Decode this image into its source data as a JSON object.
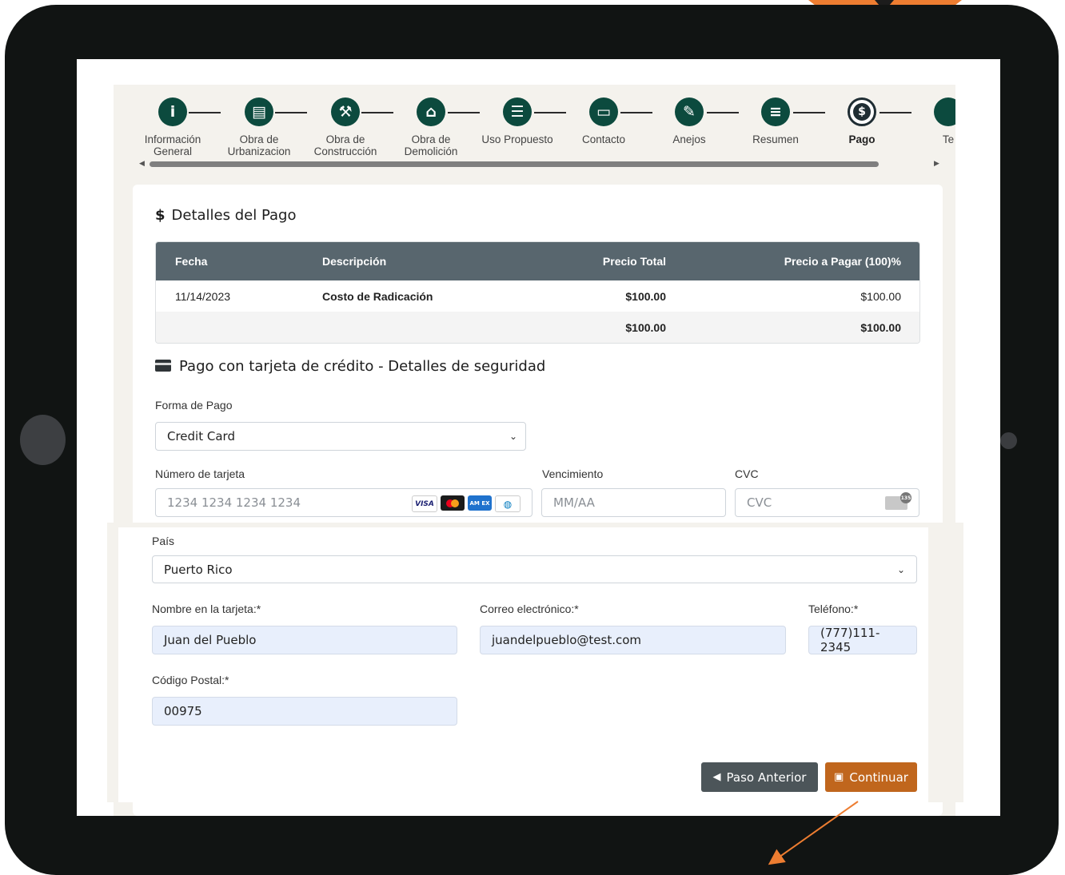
{
  "steps": [
    {
      "label": "Información General",
      "icon": "info-icon",
      "glyph": "i"
    },
    {
      "label": "Obra de Urbanizacion",
      "icon": "store-icon",
      "glyph": "▤"
    },
    {
      "label": "Obra de Construcción",
      "icon": "construction-worker-icon",
      "glyph": "⚒"
    },
    {
      "label": "Obra de Demolición",
      "icon": "house-icon",
      "glyph": "⌂"
    },
    {
      "label": "Uso Propuesto",
      "icon": "list-icon",
      "glyph": "☰"
    },
    {
      "label": "Contacto",
      "icon": "id-card-icon",
      "glyph": "▭"
    },
    {
      "label": "Anejos",
      "icon": "paperclip-icon",
      "glyph": "✎"
    },
    {
      "label": "Resumen",
      "icon": "document-icon",
      "glyph": "≡"
    },
    {
      "label": "Pago",
      "icon": "dollar-icon",
      "glyph": "$"
    },
    {
      "label": "Te",
      "icon": "terms-icon",
      "glyph": ""
    }
  ],
  "payment_details": {
    "title": "Detalles del Pago",
    "columns": [
      "Fecha",
      "Descripción",
      "Precio Total",
      "Precio a Pagar (100)%"
    ],
    "rows": [
      {
        "fecha": "11/14/2023",
        "descripcion": "Costo de Radicación",
        "precio_total": "$100.00",
        "precio_pagar": "$100.00"
      }
    ],
    "totals": {
      "precio_total": "$100.00",
      "precio_pagar": "$100.00"
    }
  },
  "credit_card": {
    "title": "Pago con tarjeta de crédito - Detalles de seguridad",
    "forma_pago_label": "Forma de Pago",
    "forma_pago_value": "Credit Card",
    "numero_label": "Número de tarjeta",
    "numero_placeholder": "1234 1234 1234 1234",
    "vencimiento_label": "Vencimiento",
    "vencimiento_placeholder": "MM/AA",
    "cvc_label": "CVC",
    "cvc_placeholder": "CVC",
    "brands": [
      "VISA",
      "Mastercard",
      "AMERICAN EXPRESS",
      "Diners"
    ],
    "cvc_badge": "135",
    "pais_label": "País",
    "pais_value": "Puerto Rico",
    "nombre_label": "Nombre en la tarjeta:*",
    "nombre_value": "Juan del Pueblo",
    "correo_label": "Correo electrónico:*",
    "correo_value": "juandelpueblo@test.com",
    "telefono_label": "Teléfono:*",
    "telefono_value": "(777)111-2345",
    "postal_label": "Código Postal:*",
    "postal_value": "00975"
  },
  "buttons": {
    "previous": "Paso Anterior",
    "continue": "Continuar"
  },
  "colors": {
    "step_circle": "#0c4a3e",
    "table_header": "#58666e",
    "continue_button": "#c0661d",
    "previous_button": "#4c5559",
    "pointer_orange": "#ed7d31",
    "tablet_frame": "#111413"
  }
}
